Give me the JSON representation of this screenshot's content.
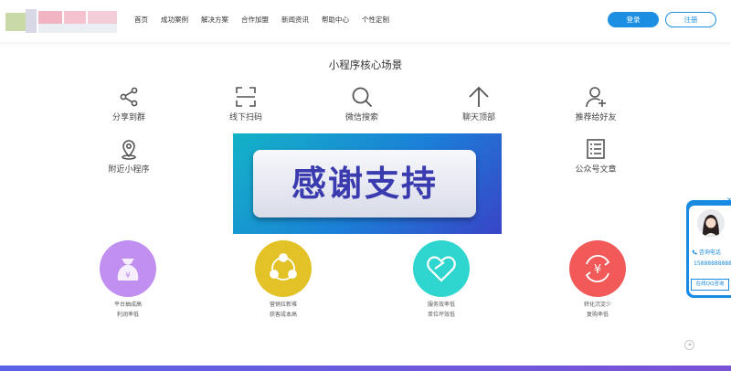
{
  "header": {
    "logo_icon": "blurred-logo",
    "nav": [
      "首页",
      "成功案例",
      "解决方案",
      "合作加盟",
      "新闻资讯",
      "帮助中心",
      "个性定制"
    ],
    "login_label": "登录",
    "register_label": "注册",
    "accent_color": "#1c8fe3"
  },
  "main": {
    "section_title": "小程序核心场景",
    "features_row1": [
      {
        "label": "分享到群",
        "icon": "share-icon"
      },
      {
        "label": "线下扫码",
        "icon": "scan-icon"
      },
      {
        "label": "微信搜索",
        "icon": "search-icon"
      },
      {
        "label": "聊天顶部",
        "icon": "arrow-up-icon"
      },
      {
        "label": "推荐给好友",
        "icon": "add-user-icon"
      }
    ],
    "features_row2": [
      {
        "label": "附近小程序",
        "icon": "location-icon"
      },
      {
        "label": "公众号文章",
        "icon": "article-icon"
      }
    ],
    "overlay_text": "感谢支持",
    "circles": [
      {
        "line1": "平台抽成高",
        "line2": "利润率低",
        "color": "#c18ff0",
        "icon": "money-bag-icon"
      },
      {
        "line1": "营销拉新难",
        "line2": "获客成本高",
        "color": "#e2c226",
        "icon": "people-icon"
      },
      {
        "line1": "服务效率低",
        "line2": "单位坪效低",
        "color": "#2fd6cf",
        "icon": "heart-icon"
      },
      {
        "line1": "转化沉淀少",
        "line2": "复购率低",
        "color": "#f25a5a",
        "icon": "yuan-refresh-icon"
      }
    ]
  },
  "side_widget": {
    "close_label": "×",
    "phone_label": "咨询电话",
    "phone": "15888888888",
    "qq_label": "在线QQ咨询"
  }
}
